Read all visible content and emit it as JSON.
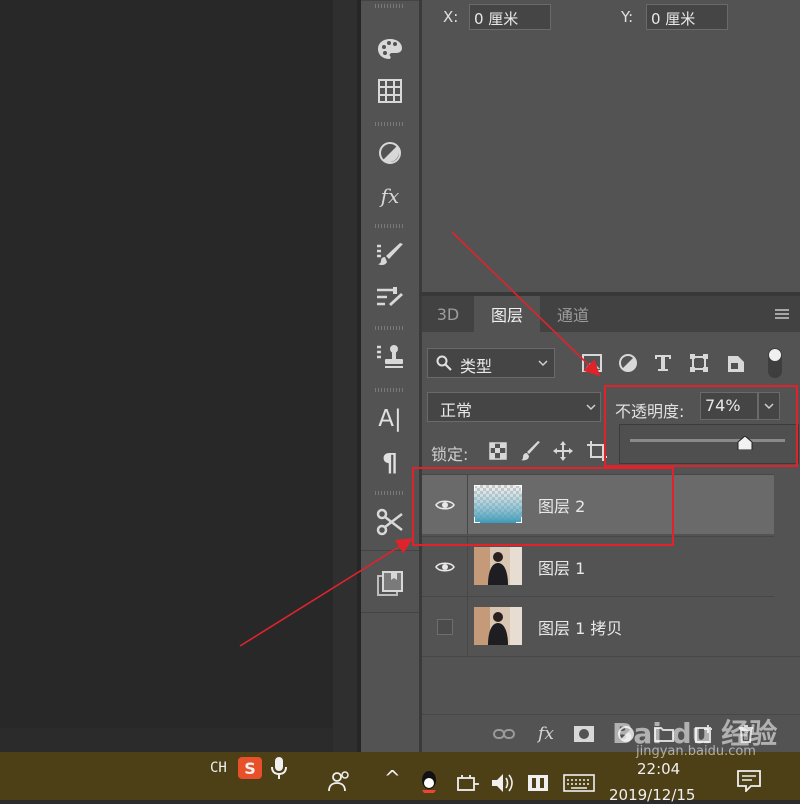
{
  "properties": {
    "x_label": "X:",
    "x_value": "0 厘米",
    "y_label": "Y:",
    "y_value": "0 厘米"
  },
  "tabs": [
    {
      "label": "3D",
      "active": false
    },
    {
      "label": "图层",
      "active": true
    },
    {
      "label": "通道",
      "active": false
    }
  ],
  "filter": {
    "kind_label": "类型",
    "icons": [
      "image-filter-icon",
      "adjustment-filter-icon",
      "type-filter-icon",
      "shape-filter-icon",
      "smart-object-filter-icon",
      "filter-toggle-icon"
    ]
  },
  "blend": {
    "mode": "正常",
    "opacity_label": "不透明度:",
    "opacity_value": "74%",
    "opacity_fraction": 0.74
  },
  "lock": {
    "label": "锁定:",
    "icons": [
      "lock-transparent-icon",
      "lock-paint-icon",
      "lock-position-icon",
      "lock-artboard-icon"
    ]
  },
  "layers": [
    {
      "name": "图层 2",
      "visible": true,
      "selected": true,
      "thumb": "gradient"
    },
    {
      "name": "图层 1",
      "visible": true,
      "selected": false,
      "thumb": "photo"
    },
    {
      "name": "图层 1 拷贝",
      "visible": false,
      "selected": false,
      "thumb": "photo"
    }
  ],
  "bottom_icons": [
    "link-layers-icon",
    "fx-icon",
    "mask-icon",
    "adjustment-icon",
    "folder-icon",
    "new-layer-icon",
    "trash-icon"
  ],
  "bottom_fx_label": "fx",
  "tools": [
    "color-swatches-icon",
    "grid-icon",
    "adjustments-icon",
    "fx-styles-icon",
    "brush-presets-icon",
    "brush-settings-icon",
    "clone-source-icon",
    "character-icon",
    "paragraph-icon",
    "tool-presets-icon",
    "libraries-icon"
  ],
  "tool_fx_label": "fx",
  "tool_character_label": "A|",
  "tool_paragraph_label": "¶",
  "taskbar": {
    "lang": "CH",
    "ime_label": "S",
    "time": "22:04",
    "date": "2019/12/15",
    "caret": "^"
  },
  "watermark": {
    "text": "Bai du 经验",
    "sub": "jingyan.baidu.com"
  },
  "colors": {
    "annotation_red": "#e0232b",
    "panel_bg": "#535353",
    "taskbar_bg": "#4d3f16"
  }
}
